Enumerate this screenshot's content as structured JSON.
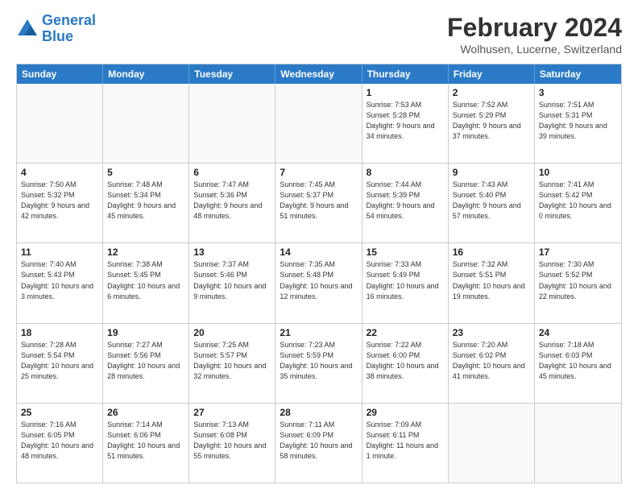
{
  "logo": {
    "line1": "General",
    "line2": "Blue"
  },
  "header": {
    "month": "February 2024",
    "location": "Wolhusen, Lucerne, Switzerland"
  },
  "weekdays": [
    "Sunday",
    "Monday",
    "Tuesday",
    "Wednesday",
    "Thursday",
    "Friday",
    "Saturday"
  ],
  "rows": [
    [
      {
        "day": "",
        "empty": true
      },
      {
        "day": "",
        "empty": true
      },
      {
        "day": "",
        "empty": true
      },
      {
        "day": "",
        "empty": true
      },
      {
        "day": "1",
        "sunrise": "7:53 AM",
        "sunset": "5:28 PM",
        "daylight": "9 hours and 34 minutes."
      },
      {
        "day": "2",
        "sunrise": "7:52 AM",
        "sunset": "5:29 PM",
        "daylight": "9 hours and 37 minutes."
      },
      {
        "day": "3",
        "sunrise": "7:51 AM",
        "sunset": "5:31 PM",
        "daylight": "9 hours and 39 minutes."
      }
    ],
    [
      {
        "day": "4",
        "sunrise": "7:50 AM",
        "sunset": "5:32 PM",
        "daylight": "9 hours and 42 minutes."
      },
      {
        "day": "5",
        "sunrise": "7:48 AM",
        "sunset": "5:34 PM",
        "daylight": "9 hours and 45 minutes."
      },
      {
        "day": "6",
        "sunrise": "7:47 AM",
        "sunset": "5:36 PM",
        "daylight": "9 hours and 48 minutes."
      },
      {
        "day": "7",
        "sunrise": "7:45 AM",
        "sunset": "5:37 PM",
        "daylight": "9 hours and 51 minutes."
      },
      {
        "day": "8",
        "sunrise": "7:44 AM",
        "sunset": "5:39 PM",
        "daylight": "9 hours and 54 minutes."
      },
      {
        "day": "9",
        "sunrise": "7:43 AM",
        "sunset": "5:40 PM",
        "daylight": "9 hours and 57 minutes."
      },
      {
        "day": "10",
        "sunrise": "7:41 AM",
        "sunset": "5:42 PM",
        "daylight": "10 hours and 0 minutes."
      }
    ],
    [
      {
        "day": "11",
        "sunrise": "7:40 AM",
        "sunset": "5:43 PM",
        "daylight": "10 hours and 3 minutes."
      },
      {
        "day": "12",
        "sunrise": "7:38 AM",
        "sunset": "5:45 PM",
        "daylight": "10 hours and 6 minutes."
      },
      {
        "day": "13",
        "sunrise": "7:37 AM",
        "sunset": "5:46 PM",
        "daylight": "10 hours and 9 minutes."
      },
      {
        "day": "14",
        "sunrise": "7:35 AM",
        "sunset": "5:48 PM",
        "daylight": "10 hours and 12 minutes."
      },
      {
        "day": "15",
        "sunrise": "7:33 AM",
        "sunset": "5:49 PM",
        "daylight": "10 hours and 16 minutes."
      },
      {
        "day": "16",
        "sunrise": "7:32 AM",
        "sunset": "5:51 PM",
        "daylight": "10 hours and 19 minutes."
      },
      {
        "day": "17",
        "sunrise": "7:30 AM",
        "sunset": "5:52 PM",
        "daylight": "10 hours and 22 minutes."
      }
    ],
    [
      {
        "day": "18",
        "sunrise": "7:28 AM",
        "sunset": "5:54 PM",
        "daylight": "10 hours and 25 minutes."
      },
      {
        "day": "19",
        "sunrise": "7:27 AM",
        "sunset": "5:56 PM",
        "daylight": "10 hours and 28 minutes."
      },
      {
        "day": "20",
        "sunrise": "7:25 AM",
        "sunset": "5:57 PM",
        "daylight": "10 hours and 32 minutes."
      },
      {
        "day": "21",
        "sunrise": "7:23 AM",
        "sunset": "5:59 PM",
        "daylight": "10 hours and 35 minutes."
      },
      {
        "day": "22",
        "sunrise": "7:22 AM",
        "sunset": "6:00 PM",
        "daylight": "10 hours and 38 minutes."
      },
      {
        "day": "23",
        "sunrise": "7:20 AM",
        "sunset": "6:02 PM",
        "daylight": "10 hours and 41 minutes."
      },
      {
        "day": "24",
        "sunrise": "7:18 AM",
        "sunset": "6:03 PM",
        "daylight": "10 hours and 45 minutes."
      }
    ],
    [
      {
        "day": "25",
        "sunrise": "7:16 AM",
        "sunset": "6:05 PM",
        "daylight": "10 hours and 48 minutes."
      },
      {
        "day": "26",
        "sunrise": "7:14 AM",
        "sunset": "6:06 PM",
        "daylight": "10 hours and 51 minutes."
      },
      {
        "day": "27",
        "sunrise": "7:13 AM",
        "sunset": "6:08 PM",
        "daylight": "10 hours and 55 minutes."
      },
      {
        "day": "28",
        "sunrise": "7:11 AM",
        "sunset": "6:09 PM",
        "daylight": "10 hours and 58 minutes."
      },
      {
        "day": "29",
        "sunrise": "7:09 AM",
        "sunset": "6:11 PM",
        "daylight": "11 hours and 1 minute."
      },
      {
        "day": "",
        "empty": true
      },
      {
        "day": "",
        "empty": true
      }
    ]
  ]
}
